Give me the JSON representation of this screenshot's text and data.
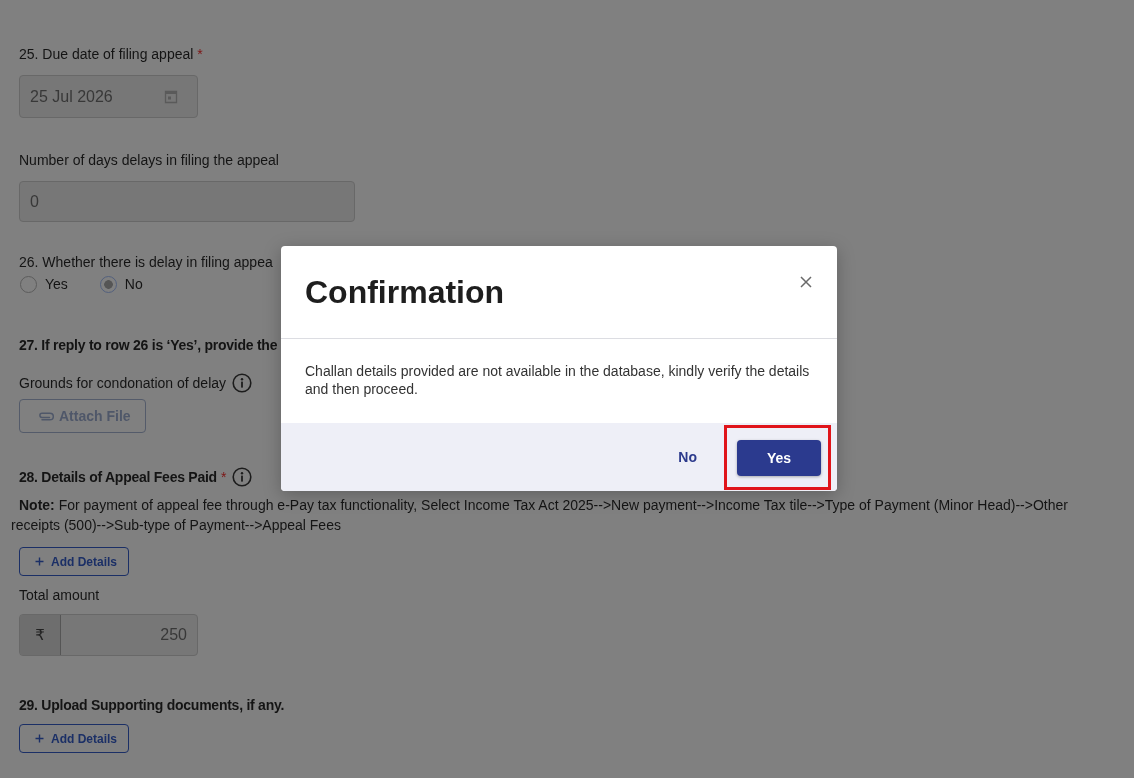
{
  "form": {
    "due_date": {
      "label": "25. Due date of filing appeal",
      "required_mark": "*",
      "value": "25 Jul 2026"
    },
    "delay_days": {
      "label": "Number of days delays in filing the appeal",
      "value": "0"
    },
    "delay_question": {
      "label": "26. Whether there is delay in filing appea",
      "options": [
        {
          "label": "Yes",
          "selected": false
        },
        {
          "label": "No",
          "selected": true
        }
      ]
    },
    "condonation": {
      "heading": "27. If reply to row 26 is ‘Yes’, provide the",
      "label": "Grounds for condonation of delay",
      "attach_button": {
        "label": "Attach File",
        "disabled": true
      }
    },
    "appeal_fees": {
      "heading": "28. Details of Appeal Fees Paid",
      "required_mark": "*",
      "note": "**Note:**  For payment of appeal fee through e-Pay tax functionality, Select Income Tax Act 2025-->New payment-->Income Tax tile-->Type of Payment (Minor Head)-->Other receipts (500)-->Sub-type of Payment-->Appeal Fees",
      "add_button": "Add Details",
      "total_label": "Total amount",
      "total": {
        "currency": "₹",
        "value": "250"
      }
    },
    "supporting_docs": {
      "heading": "29. Upload Supporting documents, if any.",
      "add_button": "Add Details"
    }
  },
  "dialog": {
    "title": "Confirmation",
    "message": "Challan details provided are not available in the database, kindly verify the details and then proceed.",
    "buttons": [
      {
        "label": "No",
        "kind": "text",
        "highlighted": false
      },
      {
        "label": "Yes",
        "kind": "primary",
        "highlighted": true
      }
    ]
  }
}
